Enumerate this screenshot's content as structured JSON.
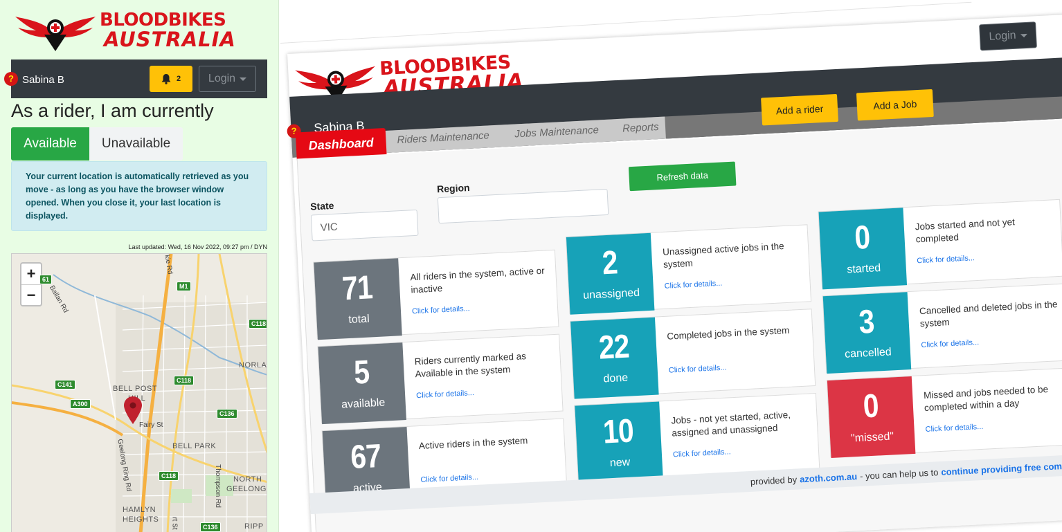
{
  "brand": {
    "line1": "BLOODBIKES",
    "line2": "AUSTRALIA"
  },
  "mobile": {
    "user": "Sabina B",
    "bell_count": "2",
    "login_label": "Login",
    "help_glyph": "?",
    "heading": "As a rider, I am currently",
    "available_label": "Available",
    "unavailable_label": "Unavailable",
    "info_text": "Your current location is automatically retrieved as you move - as long as you have the browser window opened. When you close it, your last location is displayed.",
    "last_updated": "Last updated: Wed, 16 Nov 2022, 09:27 pm / DYN",
    "map": {
      "zoom_in": "+",
      "zoom_out": "−",
      "labels": [
        "BELL POST",
        "HILL",
        "BELL PARK",
        "NORLA",
        "NORTH",
        "GEELONG",
        "HAMLYN",
        "HEIGHTS",
        "RIPP",
        "Fairy St",
        "Ballan Rd",
        "Geelong Ring Rd",
        "Thompson Rd",
        "kie Rd",
        "rt St"
      ],
      "shields": [
        "M1",
        "C118",
        "C118",
        "C141",
        "A300",
        "C136",
        "C118",
        "C136",
        "61"
      ]
    }
  },
  "desktop": {
    "user": "Sabina B",
    "help_glyph": "?",
    "login_label": "Login",
    "add_rider": "Add a rider",
    "add_job": "Add a Job",
    "tabs": {
      "dashboard": "Dashboard",
      "riders": "Riders Maintenance",
      "jobs": "Jobs Maintenance",
      "reports": "Reports"
    },
    "filters": {
      "state_label": "State",
      "state_value": "VIC",
      "region_label": "Region",
      "region_value": "",
      "refresh": "Refresh data"
    },
    "cards": [
      {
        "num": "71",
        "label": "total",
        "desc": "All riders in the system, active or inactive",
        "link": "Click for details..."
      },
      {
        "num": "5",
        "label": "available",
        "desc": "Riders currently marked as Available in the system",
        "link": "Click for details..."
      },
      {
        "num": "67",
        "label": "active",
        "desc": "Active riders in the system",
        "link": "Click for details..."
      },
      {
        "num": "2",
        "label": "unassigned",
        "desc": "Unassigned active jobs in the system",
        "link": "Click for details..."
      },
      {
        "num": "22",
        "label": "done",
        "desc": "Completed jobs in the system",
        "link": "Click for details..."
      },
      {
        "num": "10",
        "label": "new",
        "desc": "Jobs - not yet started, active, assigned and unassigned",
        "link": "Click for details..."
      },
      {
        "num": "0",
        "label": "started",
        "desc": "Jobs started and not yet completed",
        "link": "Click for details..."
      },
      {
        "num": "3",
        "label": "cancelled",
        "desc": "Cancelled and deleted jobs in the system",
        "link": "Click for details..."
      },
      {
        "num": "0",
        "label": "\"missed\"",
        "desc": "Missed and jobs needed to be completed within a day",
        "link": "Click for details..."
      }
    ],
    "footer": {
      "prefix": "provided by",
      "site": "azoth.com.au",
      "middle": "- you can help us to",
      "link": "continue providing free community"
    }
  },
  "colors": {
    "brand_red": "#d9141b",
    "grey": "#6c757d",
    "teal": "#17a2b8",
    "red": "#dc3545",
    "yellow": "#ffc107",
    "green": "#28a745"
  }
}
